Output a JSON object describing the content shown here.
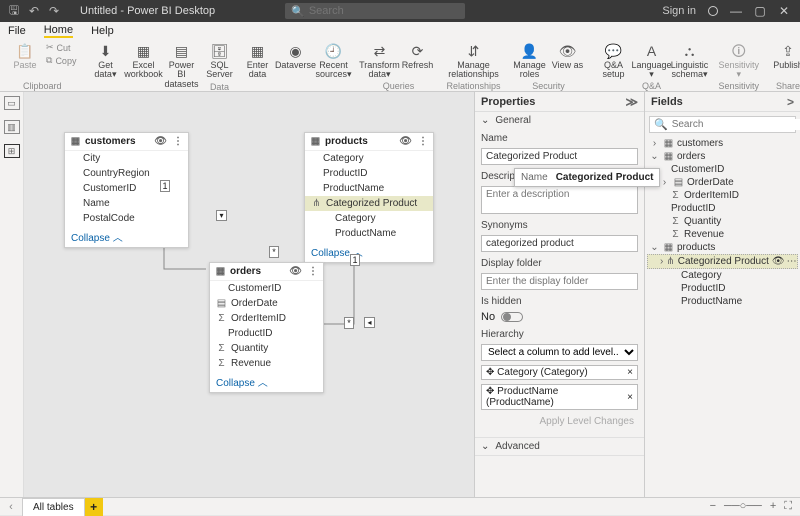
{
  "titlebar": {
    "title": "Untitled - Power BI Desktop",
    "search_ph": "Search",
    "signin": "Sign in"
  },
  "menu": {
    "file": "File",
    "home": "Home",
    "help": "Help"
  },
  "ribbon": {
    "clip": {
      "paste": "Paste",
      "cut": "Cut",
      "copy": "Copy",
      "label": "Clipboard"
    },
    "data": {
      "get": "Get data▾",
      "excel": "Excel workbook",
      "pbids": "Power BI datasets",
      "sql": "SQL Server",
      "enter": "Enter data",
      "dv": "Dataverse",
      "recent": "Recent sources▾",
      "label": "Data"
    },
    "queries": {
      "transform": "Transform data▾",
      "refresh": "Refresh",
      "label": "Queries"
    },
    "rel": {
      "manage": "Manage relationships",
      "label": "Relationships"
    },
    "sec": {
      "roles": "Manage roles",
      "view": "View as",
      "label": "Security"
    },
    "qa": {
      "setup": "Q&A setup",
      "lang": "Language ▾",
      "ling": "Linguistic schema▾",
      "label": "Q&A"
    },
    "sens": {
      "sens": "Sensitivity ▾",
      "label": "Sensitivity"
    },
    "share": {
      "pub": "Publish",
      "label": "Share"
    }
  },
  "entities": {
    "customers": {
      "title": "customers",
      "fields": [
        "City",
        "CountryRegion",
        "CustomerID",
        "Name",
        "PostalCode"
      ],
      "collapse": "Collapse"
    },
    "products": {
      "title": "products",
      "fields": [
        "Category",
        "ProductID",
        "ProductName"
      ],
      "hier": "Categorized Product",
      "hfields": [
        "Category",
        "ProductName"
      ],
      "collapse": "Collapse"
    },
    "orders": {
      "title": "orders",
      "fields": [
        "CustomerID",
        "OrderDate",
        "OrderItemID",
        "ProductID",
        "Quantity",
        "Revenue"
      ],
      "collapse": "Collapse"
    }
  },
  "props": {
    "title": "Properties",
    "general": "General",
    "advanced": "Advanced",
    "name_l": "Name",
    "name_v": "Categorized Product",
    "desc_l": "Description",
    "desc_ph": "Enter a description",
    "syn_l": "Synonyms",
    "syn_v": "categorized product",
    "disp_l": "Display folder",
    "disp_ph": "Enter the display folder",
    "hidden_l": "Is hidden",
    "hidden_v": "No",
    "hier_l": "Hierarchy",
    "hier_sel": "Select a column to add level...",
    "hier1": "Category (Category)",
    "hier2": "ProductName (ProductName)",
    "apply": "Apply Level Changes"
  },
  "fields": {
    "title": "Fields",
    "search_ph": "Search",
    "customers": "customers",
    "orders": "orders",
    "o1": "CustomerID",
    "o2": "OrderDate",
    "o3": "OrderItemID",
    "o4": "ProductID",
    "o5": "Quantity",
    "o6": "Revenue",
    "products": "products",
    "p_hier": "Categorized Product",
    "p1": "Category",
    "p2": "ProductID",
    "p3": "ProductName"
  },
  "tooltip": {
    "k": "Name",
    "v": "Categorized Product"
  },
  "bottom": {
    "tab": "All tables"
  },
  "rel": {
    "one": "1",
    "many": "*"
  }
}
